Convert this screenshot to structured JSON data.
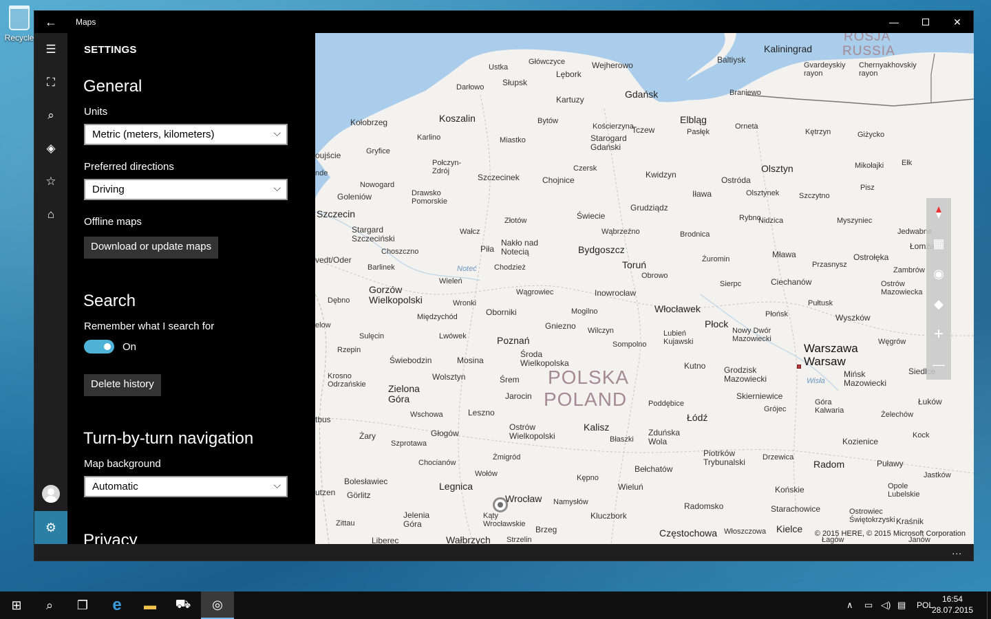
{
  "desktop": {
    "recycle_label": "Recycle"
  },
  "window": {
    "title": "Maps",
    "back_glyph": "←",
    "min_glyph": "—",
    "close_glyph": "✕"
  },
  "rail": {
    "hamburger_glyph": "☰",
    "items": [
      {
        "name": "map-icon",
        "glyph": "⛶"
      },
      {
        "name": "search-icon",
        "glyph": "⌕"
      },
      {
        "name": "directions-icon",
        "glyph": "◈"
      },
      {
        "name": "favorites-icon",
        "glyph": "☆"
      },
      {
        "name": "cities-3d-icon",
        "glyph": "⌂"
      }
    ],
    "settings_glyph": "⚙"
  },
  "settings": {
    "title": "SETTINGS",
    "general": {
      "heading": "General",
      "units_label": "Units",
      "units_value": "Metric (meters, kilometers)",
      "directions_label": "Preferred directions",
      "directions_value": "Driving",
      "offline_label": "Offline maps",
      "download_button": "Download or update maps"
    },
    "search": {
      "heading": "Search",
      "remember_label": "Remember what I search for",
      "toggle_state": "On",
      "delete_button": "Delete history"
    },
    "navigation": {
      "heading": "Turn-by-turn navigation",
      "bg_label": "Map background",
      "bg_value": "Automatic"
    },
    "privacy": {
      "heading": "Privacy"
    },
    "chevron_glyph": "⌵"
  },
  "map": {
    "labels": {
      "kaliningrad": "Kaliningrad",
      "rosja": "ROSJA",
      "russia": "RUSSIA",
      "baltiysk": "Baltiysk",
      "gvardeyskiy": "Gvardeyskiy\nrayon",
      "chernyakhovskiy": "Chernyakhovskiy\nrayon",
      "ustka": "Ustka",
      "glowczyce": "Główczyce",
      "wejherowo": "Wejherowo",
      "lebork": "Lębork",
      "darlowo": "Darłowo",
      "slupsk": "Słupsk",
      "gdansk": "Gdańsk",
      "braniewo": "Braniewo",
      "kartuzy": "Kartuzy",
      "kolobrzeg": "Kołobrzeg",
      "koszalin": "Koszalin",
      "bytow": "Bytów",
      "koscierzyna": "Kościerzyna",
      "tczew": "Tczew",
      "elblag": "Elbląg",
      "orneta": "Orneta",
      "ketrzyn": "Kętrzyn",
      "gizycko": "Giżycko",
      "pasleka": "Pasłęk",
      "starogard": "Starogard\nGdański",
      "karlino": "Karlino",
      "miastko": "Miastko",
      "gryfice": "Gryfice",
      "ujscie": "oujście",
      "polczyn": "Połczyn-\nZdrój",
      "czersk": "Czersk",
      "kwidzyn": "Kwidzyn",
      "olsztyn": "Olsztyn",
      "mikolajki": "Mikołajki",
      "elk": "Ełk",
      "nde": "nde",
      "szczecinek": "Szczecinek",
      "chojnice": "Chojnice",
      "ostroda": "Ostróda",
      "nowogard": "Nowogard",
      "golenow": "Goleniów",
      "drawsko": "Drawsko\nPomorskie",
      "ilawa": "Iława",
      "olsztynek": "Olsztynek",
      "szczytno": "Szczytno",
      "pisz": "Pisz",
      "szczecin": "Szczecin",
      "grudziadz": "Grudziądz",
      "swiecie": "Świecie",
      "rybno": "Rybno",
      "nidzica": "Nidzica",
      "myszyniec": "Myszyniec",
      "zlotow": "Złotów",
      "stargard": "Stargard\nSzczeciński",
      "walcz": "Wałcz",
      "wabrzezno": "Wąbrzeźno",
      "brodnica": "Brodnica",
      "jedwabne": "Jedwabne",
      "nakło": "Nakło nad\nNotecią",
      "pila": "Piła",
      "choszczno": "Choszczno",
      "bydgoszcz": "Bydgoszcz",
      "zuromin": "Żuromin",
      "mlawa": "Mława",
      "lomza": "Łomża",
      "ostroleka": "Ostrołęka",
      "przasnysz": "Przasnysz",
      "odra": "vedt/Oder",
      "barlinek": "Barlinek",
      "notec": "Noteć",
      "chodziez": "Chodzież",
      "torun": "Toruń",
      "obrowo": "Obrowo",
      "zambrow": "Zambrów",
      "wielen": "Wieleń",
      "sierpc": "Sierpc",
      "ciechanow": "Ciechanów",
      "ostrow_maz": "Ostrów\nMazowiecka",
      "gorzow": "Gorzów\nWielkopolski",
      "debno": "Dębno",
      "wagrowiec": "Wągrowiec",
      "inowroclaw": "Inowrocław",
      "pultusk": "Pułtusk",
      "wronki": "Wronki",
      "wloclawek": "Włocławek",
      "mogilno": "Mogilno",
      "miedzychod": "Międzychód",
      "oborniki": "Oborniki",
      "plonsk": "Płońsk",
      "wyszkow": "Wyszków",
      "elow": "elow",
      "gniezno": "Gniezno",
      "wilczyn": "Wilczyn",
      "plock": "Płock",
      "nowy_dwor": "Nowy Dwór\nMazowiecki",
      "lwowek": "Lwówek",
      "sulecin": "Sulęcin",
      "poznan": "Poznań",
      "lubien": "Lubień\nKujawski",
      "wegrow": "Węgrów",
      "rzepin": "Rzepin",
      "sompolno": "Sompolno",
      "warszawa": "Warszawa",
      "warsaw": "Warsaw",
      "sroda": "Środa\nWielkopolska",
      "swiebodzin": "Świebodzin",
      "mosina": "Mosina",
      "krosno": "Krosno\nOdrzańskie",
      "wolsztyn": "Wolsztyn",
      "polska": "POLSKA",
      "poland": "POLAND",
      "kutno": "Kutno",
      "grodzisk": "Grodzisk\nMazowiecki",
      "siedlce": "Siedlce",
      "srem": "Śrem",
      "minsk": "Mińsk\nMazowiecki",
      "wisla": "Wisła",
      "zielona": "Zielona\nGóra",
      "jarocin": "Jarocin",
      "poddebice": "Poddębice",
      "skierniewice": "Skierniewice",
      "lukow": "Łuków",
      "gora_kalwaria": "Góra\nKalwaria",
      "grojec": "Grójec",
      "bus": "tbus",
      "wschowa": "Wschowa",
      "leszno": "Leszno",
      "lodz": "Łódź",
      "zelechow": "Żelechów",
      "zary": "Żary",
      "glogow": "Głogów",
      "ostrow_wlkp": "Ostrów\nWielkopolski",
      "kalisz": "Kalisz",
      "zdunska": "Zduńska\nWola",
      "kozienice": "Kozienice",
      "kock": "Kock",
      "szprotawa": "Szprotawa",
      "blaszki": "Błaszki",
      "chocianow": "Chocianów",
      "zmigrod": "Żmigród",
      "piotrkow": "Piotrków\nTrybunalski",
      "drzewica": "Drzewica",
      "radom": "Radom",
      "pulawy": "Puławy",
      "wolow": "Wołów",
      "belchatow": "Bełchatów",
      "boleslawiec": "Bolesławiec",
      "kepno": "Kępno",
      "jastkow": "Jastków",
      "legnica": "Legnica",
      "wielun": "Wieluń",
      "konskie": "Końskie",
      "opole_lub": "Opole\nLubelskie",
      "zgorzelec": "utzen",
      "gorlitz": "Görlitz",
      "wroclaw": "Wrocław",
      "namyslow": "Namysłów",
      "radomsko": "Radomsko",
      "starachowice": "Starachowice",
      "ostrowiec": "Ostrowiec\nŚwiętokrzyski",
      "krasnik": "Kraśnik",
      "jelenia": "Jelenia\nGóra",
      "katy": "Kąty\nWrocławskie",
      "kluczbork": "Kluczbork",
      "zittau": "Zittau",
      "brzeg": "Brzeg",
      "czestochowa": "Częstochowa",
      "wloszczowa": "Włoszczowa",
      "kielce": "Kielce",
      "liberec": "Liberec",
      "walbrzych": "Wałbrzych",
      "strzelin": "Strzelin",
      "lagow": "Łagów",
      "janow": "Janów"
    },
    "copyright": "© 2015 HERE, © 2015 Microsoft Corporation",
    "tools": [
      {
        "name": "compass-icon"
      },
      {
        "name": "aerial-view-icon",
        "glyph": "▦"
      },
      {
        "name": "show-my-location-icon",
        "glyph": "◉"
      },
      {
        "name": "map-layers-icon",
        "glyph": "◆"
      },
      {
        "name": "zoom-in-icon",
        "glyph": "+"
      },
      {
        "name": "zoom-out-icon",
        "glyph": "—"
      }
    ],
    "more_glyph": "..."
  },
  "taskbar": {
    "start_glyph": "⊞",
    "search_glyph": "⌕",
    "taskview_glyph": "❐",
    "edge_glyph": "e",
    "explorer_glyph": "▬",
    "store_glyph": "⛟",
    "maps_glyph": "◎",
    "tray_chevron": "∧",
    "language": "POL",
    "time": "16:54",
    "date": "28.07.2015"
  }
}
